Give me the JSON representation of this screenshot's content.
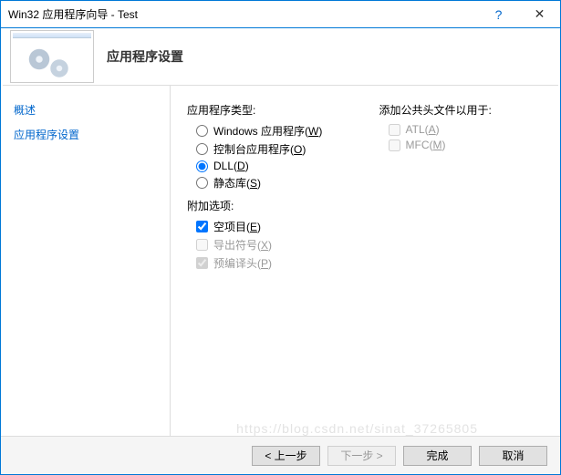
{
  "titlebar": {
    "title": "Win32 应用程序向导 - Test",
    "help": "?",
    "close": "✕"
  },
  "banner": {
    "title": "应用程序设置"
  },
  "sidebar": {
    "items": [
      {
        "label": "概述"
      },
      {
        "label": "应用程序设置"
      }
    ]
  },
  "content": {
    "appTypeLabel": "应用程序类型:",
    "radios": [
      {
        "label": "Windows 应用程序(",
        "key": "W",
        "tail": ")",
        "checked": false
      },
      {
        "label": "控制台应用程序(",
        "key": "O",
        "tail": ")",
        "checked": false
      },
      {
        "label": "DLL(",
        "key": "D",
        "tail": ")",
        "checked": true
      },
      {
        "label": "静态库(",
        "key": "S",
        "tail": ")",
        "checked": false
      }
    ],
    "addOptionsLabel": "附加选项:",
    "checks": [
      {
        "label": "空项目(",
        "key": "E",
        "tail": ")",
        "checked": true,
        "disabled": false
      },
      {
        "label": "导出符号(",
        "key": "X",
        "tail": ")",
        "checked": false,
        "disabled": true
      },
      {
        "label": "预编译头(",
        "key": "P",
        "tail": ")",
        "checked": true,
        "disabled": true
      }
    ],
    "commonHeadersLabel": "添加公共头文件以用于:",
    "commonHeaders": [
      {
        "label": "ATL(",
        "key": "A",
        "tail": ")",
        "checked": false,
        "disabled": true
      },
      {
        "label": "MFC(",
        "key": "M",
        "tail": ")",
        "checked": false,
        "disabled": true
      }
    ]
  },
  "footer": {
    "back": "< 上一步",
    "next": "下一步 >",
    "finish": "完成",
    "cancel": "取消"
  },
  "watermark": "https://blog.csdn.net/sinat_37265805"
}
